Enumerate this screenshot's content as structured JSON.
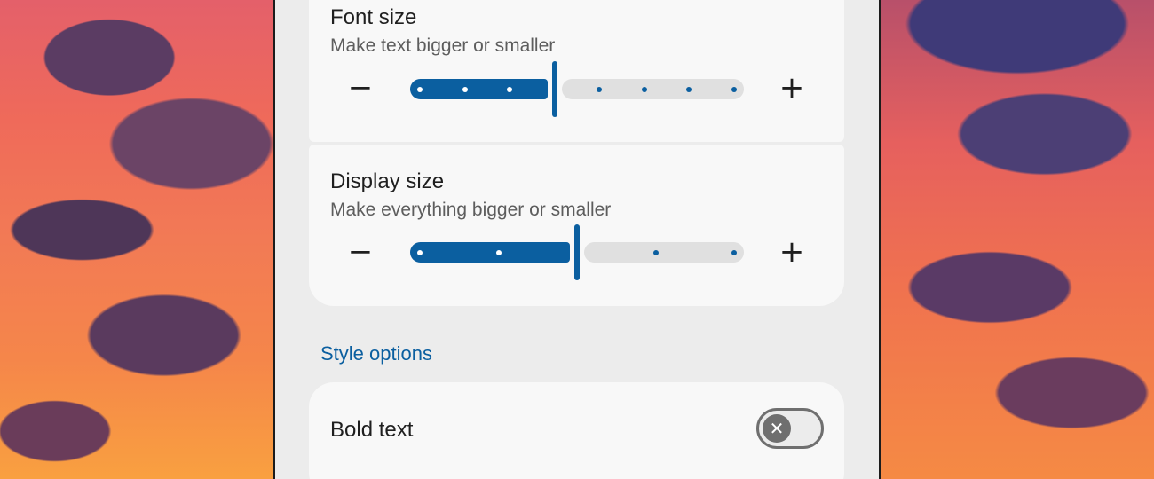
{
  "font_size": {
    "title": "Font size",
    "subtitle": "Make text bigger or smaller",
    "minus_glyph": "−",
    "plus_glyph": "+",
    "level": 3,
    "steps": 8
  },
  "display_size": {
    "title": "Display size",
    "subtitle": "Make everything bigger or smaller",
    "minus_glyph": "−",
    "plus_glyph": "+",
    "level": 2,
    "steps": 5
  },
  "style_options": {
    "header": "Style options",
    "bold_text": {
      "label": "Bold text",
      "enabled": false,
      "knob_glyph": "✕"
    }
  },
  "colors": {
    "accent": "#0b5fa0",
    "card": "#f8f8f8",
    "background": "#ececec",
    "toggle_off": "#6f6f6f"
  },
  "icons": {
    "decrease": "minus-icon",
    "increase": "plus-icon",
    "toggle_off": "close-icon"
  }
}
